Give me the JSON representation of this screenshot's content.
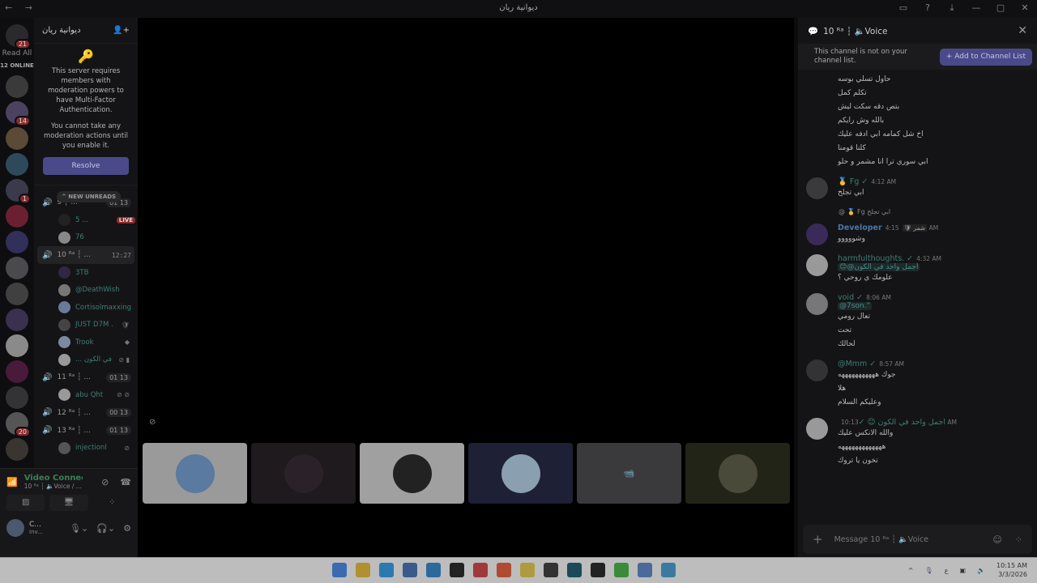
{
  "window": {
    "title": "ديوانية ريان",
    "nav": "← →",
    "controls": [
      "▭",
      "?",
      "⤓",
      "—",
      "▢",
      "✕"
    ]
  },
  "rail": {
    "home_badge": "21",
    "read_all": "Read All",
    "online": "12 ONLINE",
    "servers": [
      {
        "c": "#3a3a3a",
        "badge": ""
      },
      {
        "c": "#4a4260",
        "badge": "14"
      },
      {
        "c": "#5a4a36",
        "badge": ""
      },
      {
        "c": "#2e4a5a",
        "badge": ""
      },
      {
        "c": "#3a3a4a",
        "badge": "1"
      },
      {
        "c": "#6a2030",
        "badge": ""
      },
      {
        "c": "#30305a",
        "badge": ""
      },
      {
        "c": "#4a4a4e",
        "badge": ""
      },
      {
        "c": "#404040",
        "badge": ""
      },
      {
        "c": "#3a3050",
        "badge": ""
      },
      {
        "c": "#8a8a8a",
        "badge": ""
      },
      {
        "c": "#4a1a3a",
        "badge": ""
      },
      {
        "c": "#333",
        "badge": ""
      },
      {
        "c": "#555",
        "badge": "20"
      },
      {
        "c": "#3a3530",
        "badge": ""
      }
    ]
  },
  "server": {
    "name": "ديوانية ريان",
    "mfa_text1": "This server requires members with moderation powers to have Multi-Factor Authentication.",
    "mfa_text2": "You cannot take any moderation actions until you enable it.",
    "resolve": "Resolve",
    "new_unreads": "^ NEW UNREADS"
  },
  "channels": [
    {
      "type": "vc",
      "name": "9 ┆ ...",
      "count": "01 13",
      "active": true
    },
    {
      "type": "mem",
      "name": "5 ...",
      "live": "LIVE",
      "c": "#222"
    },
    {
      "type": "mem",
      "name": "76",
      "c": "#888"
    },
    {
      "type": "vc",
      "name": "10 ᴿᵃ ┆ ...",
      "time": "12:27",
      "active": true,
      "sel": true
    },
    {
      "type": "mem",
      "name": "3TB",
      "c": "#302840"
    },
    {
      "type": "mem",
      "name": "@DeathWish",
      "c": "#777"
    },
    {
      "type": "mem",
      "name": "Cortisolmaxxing",
      "c": "#6a7a9a"
    },
    {
      "type": "mem",
      "name": "JUST D7M .",
      "c": "#444",
      "ic": "🛡"
    },
    {
      "type": "mem",
      "name": "Trook",
      "c": "#7a8aa0",
      "ic": "◆"
    },
    {
      "type": "mem",
      "name": "... في الكون",
      "c": "#999",
      "ic": "⊘ ▮"
    },
    {
      "type": "vc",
      "name": "11 ᴿᵃ ┆ ...",
      "count": "01 13",
      "active": true
    },
    {
      "type": "mem",
      "name": "abu Qht",
      "c": "#999",
      "ic": "⊘ ⊘"
    },
    {
      "type": "vc",
      "name": "12 ᴿᵃ ┆ ...",
      "count": "00 13",
      "active": false
    },
    {
      "type": "vc",
      "name": "13 ᴿᵃ ┆ ...",
      "count": "01 13",
      "active": true
    },
    {
      "type": "mem",
      "name": "injectionl",
      "c": "#555",
      "ic": "⊘"
    }
  ],
  "voice_panel": {
    "status": "Video Connected",
    "sub": "10 ᴿᵃ ┆ 🔈Voice / ...",
    "user_name": "C...",
    "user_status": "Inv..."
  },
  "chat": {
    "header": "10 ᴿᵃ ┆ 🔈Voice",
    "notice": "This channel is not on your channel list.",
    "add_button": "+ Add to Channel List",
    "lines": [
      "حاول تسلي بوسه",
      "تكلم كمل",
      "بتص دقه سكت ليش",
      "بالله وش رايكم",
      "اخ   شل كمامه ابي ادفه عليك",
      "كلنا قومنا",
      "ابي سوري ترا انا مشمر و حلو"
    ],
    "messages": [
      {
        "name": "🥇 Fg ✓",
        "ts": "4:12 AM",
        "c": "#3a3a3a",
        "lines": [
          "ابي تجلخ"
        ]
      },
      {
        "reply": "ابي تجلخ  Fg 🥇 @",
        "name": "Developer",
        "name_color": "#4a76a8",
        "tag": "شمر 🛡",
        "ts": "4:15 AM",
        "c": "#3a2a5a",
        "lines": [
          "وشووووو"
        ]
      },
      {
        "name": "harmfulthoughts. ✓",
        "ts": "4:32 AM",
        "c": "#999",
        "mention": "😊@اجمل واحد في الكون",
        "lines": [
          "علومك ي روحي ؟"
        ]
      },
      {
        "name": "void ✓",
        "ts": "8:06 AM",
        "c": "#777",
        "mention": "@7son.”",
        "lines": [
          "تعال رومي",
          "تحت",
          "لحالك"
        ]
      },
      {
        "name": "@Mmm ✓",
        "ts": "8:57 AM",
        "c": "#333",
        "lines": [
          "جوك هههههههههههه",
          "هلا",
          "وعليكم السلام"
        ]
      },
      {
        "name": "اجمل واحد في الكون 😊 ✓",
        "ts": "10:13 AM",
        "c": "#999",
        "lines": [
          "والله الانكس عليك",
          "هههههههههههههه",
          "تخون يا تروك"
        ]
      }
    ],
    "composer_placeholder": "Message 10 ᴿᵃ ┆ 🔈Voice"
  },
  "tiles": [
    {
      "bg": "#9a9a9a",
      "f": "#5a7aa0"
    },
    {
      "bg": "#1e1a1e",
      "f": "#2a2228"
    },
    {
      "bg": "#a0a0a0",
      "f": "#222"
    },
    {
      "bg": "#1e2036",
      "f": "#8aa0b0"
    },
    {
      "bg": "#3a3a3c",
      "f": "",
      "cam": "📹"
    },
    {
      "bg": "#232418",
      "f": "#4a4a3a"
    }
  ],
  "taskbar": {
    "apps": [
      "#3a6ab0",
      "#b09030",
      "#2a7ab0",
      "#3a5a8a",
      "#2a6a9a",
      "#222",
      "#a03a3a",
      "#b04a30",
      "#b09a40",
      "#333",
      "#1a4a5a",
      "#222",
      "#3a8a3a",
      "#4a6a9a",
      "#3a7aa0"
    ],
    "time": "10:15 AM",
    "date": "3/3/2026",
    "lang": "ع"
  }
}
